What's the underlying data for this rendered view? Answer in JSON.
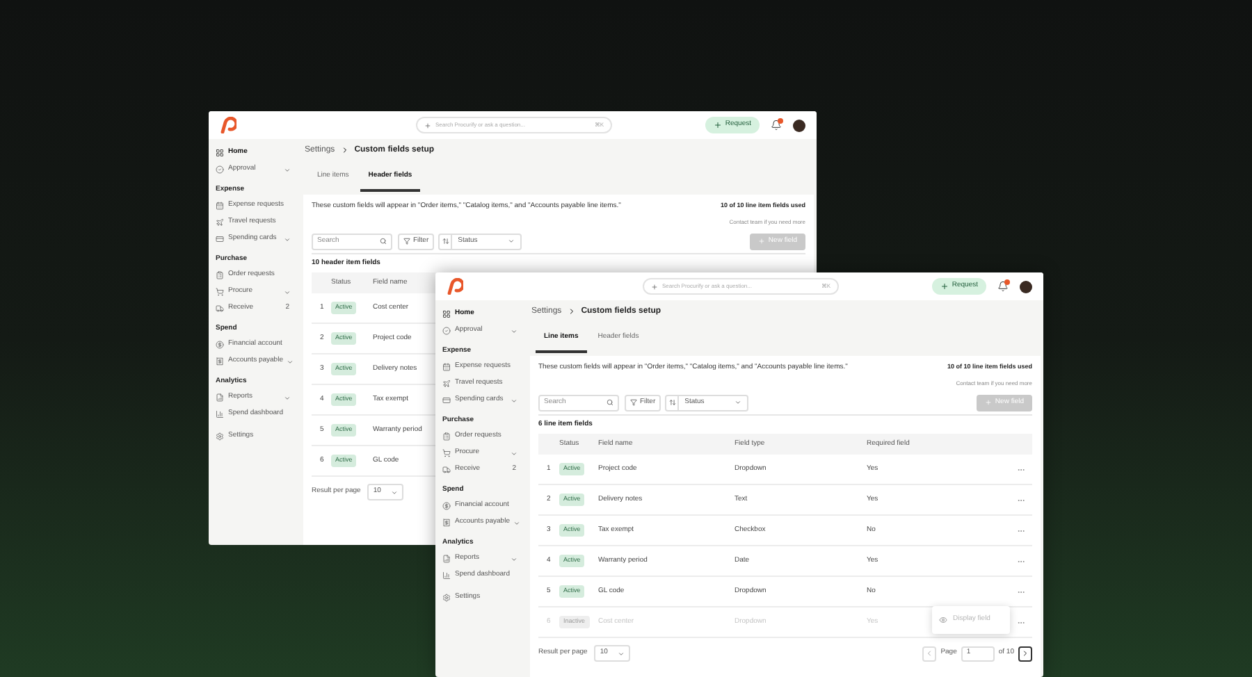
{
  "windows": [
    {
      "kind": "back",
      "search": {
        "placeholder": "Search Procurify or ask a question...",
        "shortcut": "⌘K"
      },
      "request_button": "Request",
      "notification": true,
      "sidebar": {
        "items": [
          {
            "label": "Home",
            "selected": true,
            "expandable": false
          },
          {
            "label": "Approval",
            "selected": false,
            "expandable": true
          }
        ],
        "sections": [
          {
            "title": "Expense",
            "items": [
              {
                "label": "Expense requests",
                "selected": false,
                "expandable": false
              },
              {
                "label": "Travel requests",
                "selected": false,
                "expandable": false
              },
              {
                "label": "Spending cards",
                "selected": false,
                "expandable": true
              }
            ]
          },
          {
            "title": "Purchase",
            "items": [
              {
                "label": "Order requests",
                "selected": false,
                "expandable": false
              },
              {
                "label": "Procure",
                "selected": false,
                "expandable": true
              },
              {
                "label": "Receive",
                "selected": false,
                "expandable": false,
                "count": "2"
              }
            ]
          },
          {
            "title": "Spend",
            "items": [
              {
                "label": "Financial account",
                "selected": false,
                "expandable": false
              },
              {
                "label": "Accounts payable",
                "selected": false,
                "expandable": true
              }
            ]
          },
          {
            "title": "Analytics",
            "items": [
              {
                "label": "Reports",
                "selected": false,
                "expandable": true
              },
              {
                "label": "Spend dashboard",
                "selected": false,
                "expandable": false
              }
            ]
          }
        ],
        "footer": [
          {
            "label": "Settings",
            "selected": false,
            "expandable": false
          }
        ]
      },
      "breadcrumb": [
        "Settings",
        "Custom fields setup"
      ],
      "tabs": [
        {
          "label": "Line items",
          "selected": false
        },
        {
          "label": "Header fields",
          "selected": true
        }
      ],
      "description": "These custom fields will appear in \"Order items,\" \"Catalog items,\" and \"Accounts payable line items.\"",
      "usage": "10 of 10 line item fields used",
      "usage_note": "Contact team if you need more",
      "toolbar": {
        "search_placeholder": "Search",
        "filter": "Filter",
        "status": "Status",
        "new_field": {
          "label": "New field",
          "disabled": true
        }
      },
      "count_label": "10 header item fields",
      "table": {
        "columns": [
          "",
          "Status",
          "Field name"
        ],
        "row_menu": false,
        "rows": [
          {
            "active": true,
            "cells": [
              "1",
              "Active",
              "Cost center"
            ]
          },
          {
            "active": true,
            "cells": [
              "2",
              "Active",
              "Project code"
            ]
          },
          {
            "active": true,
            "cells": [
              "3",
              "Active",
              "Delivery notes"
            ]
          },
          {
            "active": true,
            "cells": [
              "4",
              "Active",
              "Tax exempt"
            ]
          },
          {
            "active": true,
            "cells": [
              "5",
              "Active",
              "Warranty period"
            ]
          },
          {
            "active": true,
            "cells": [
              "6",
              "Active",
              "GL code"
            ]
          }
        ]
      },
      "pagination": {
        "label": "Result per page",
        "per_page": "10"
      }
    },
    {
      "kind": "front",
      "search": {
        "placeholder": "Search Procurify or ask a question...",
        "shortcut": "⌘K"
      },
      "request_button": "Request",
      "notification": true,
      "sidebar": {
        "items": [
          {
            "label": "Home",
            "selected": true,
            "expandable": false
          },
          {
            "label": "Approval",
            "selected": false,
            "expandable": true
          }
        ],
        "sections": [
          {
            "title": "Expense",
            "items": [
              {
                "label": "Expense requests",
                "selected": false,
                "expandable": false
              },
              {
                "label": "Travel requests",
                "selected": false,
                "expandable": false
              },
              {
                "label": "Spending cards",
                "selected": false,
                "expandable": true
              }
            ]
          },
          {
            "title": "Purchase",
            "items": [
              {
                "label": "Order requests",
                "selected": false,
                "expandable": false
              },
              {
                "label": "Procure",
                "selected": false,
                "expandable": true
              },
              {
                "label": "Receive",
                "selected": false,
                "expandable": false,
                "count": "2"
              }
            ]
          },
          {
            "title": "Spend",
            "items": [
              {
                "label": "Financial account",
                "selected": false,
                "expandable": false
              },
              {
                "label": "Accounts payable",
                "selected": false,
                "expandable": true
              }
            ]
          },
          {
            "title": "Analytics",
            "items": [
              {
                "label": "Reports",
                "selected": false,
                "expandable": true
              },
              {
                "label": "Spend dashboard",
                "selected": false,
                "expandable": false
              }
            ]
          }
        ],
        "footer": [
          {
            "label": "Settings",
            "selected": false,
            "expandable": false
          }
        ]
      },
      "breadcrumb": [
        "Settings",
        "Custom fields setup"
      ],
      "tabs": [
        {
          "label": "Line items",
          "selected": true
        },
        {
          "label": "Header fields",
          "selected": false
        }
      ],
      "description": "These custom fields will appear in \"Order items,\" \"Catalog items,\" and \"Accounts payable line items.\"",
      "usage": "10 of 10 line item fields used",
      "usage_note": "Contact team if you need more",
      "toolbar": {
        "search_placeholder": "Search",
        "filter": "Filter",
        "status": "Status",
        "new_field": {
          "label": "New field",
          "disabled": true
        }
      },
      "count_label": "6 line item fields",
      "table": {
        "columns": [
          "",
          "Status",
          "Field name",
          "Field type",
          "Required field"
        ],
        "row_menu": true,
        "rows": [
          {
            "active": true,
            "cells": [
              "1",
              "Active",
              "Project code",
              "Dropdown",
              "Yes"
            ]
          },
          {
            "active": true,
            "cells": [
              "2",
              "Active",
              "Delivery notes",
              "Text",
              "Yes"
            ]
          },
          {
            "active": true,
            "cells": [
              "3",
              "Active",
              "Tax exempt",
              "Checkbox",
              "No"
            ]
          },
          {
            "active": true,
            "cells": [
              "4",
              "Active",
              "Warranty period",
              "Date",
              "Yes"
            ]
          },
          {
            "active": true,
            "cells": [
              "5",
              "Active",
              "GL code",
              "Dropdown",
              "No"
            ]
          },
          {
            "active": false,
            "cells": [
              "6",
              "Inactive",
              "Cost center",
              "Dropdown",
              "Yes"
            ]
          }
        ],
        "row_popup": {
          "label": "Display field"
        }
      },
      "pagination": {
        "label": "Result per page",
        "per_page": "10",
        "page_label": "Page",
        "page": "1",
        "page_total": "of 10"
      }
    }
  ]
}
